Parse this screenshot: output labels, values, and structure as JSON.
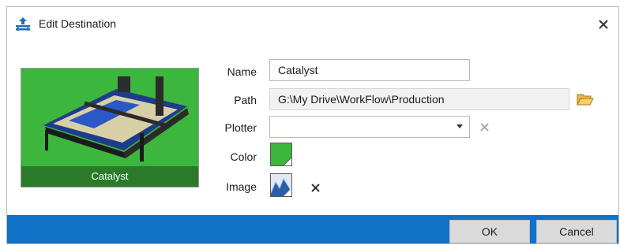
{
  "dialog": {
    "title": "Edit Destination",
    "title_icon": "upload-destination-icon",
    "close_icon": "close-icon"
  },
  "preview": {
    "caption": "Catalyst",
    "background_color": "#3cb63c",
    "image": "cutting-table-machine"
  },
  "form": {
    "name_label": "Name",
    "name_value": "Catalyst",
    "path_label": "Path",
    "path_value": "G:\\My Drive\\WorkFlow\\Production",
    "path_browse_icon": "folder-open-icon",
    "plotter_label": "Plotter",
    "plotter_value": "",
    "plotter_clear_icon": "clear-icon",
    "color_label": "Color",
    "color_value": "#3cb63c",
    "image_label": "Image",
    "image_thumbnail_icon": "image-thumbnail-icon",
    "image_clear_icon": "clear-icon"
  },
  "footer": {
    "ok_label": "OK",
    "cancel_label": "Cancel",
    "accent_color": "#0f72c6"
  }
}
